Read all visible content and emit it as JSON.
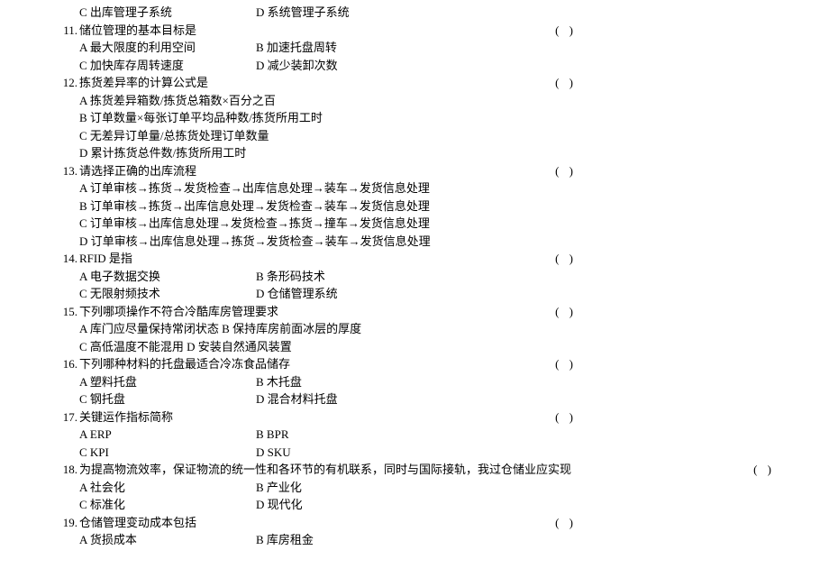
{
  "paren": "(   )",
  "pre_options": {
    "c": "C 出库管理子系统",
    "d": "D 系统管理子系统"
  },
  "questions": [
    {
      "num": "11.",
      "text": "储位管理的基本目标是",
      "opts_rows": [
        {
          "a": "A 最大限度的利用空间",
          "b": "B 加速托盘周转"
        },
        {
          "a": "C 加快库存周转速度",
          "b": "D 减少装卸次数"
        }
      ]
    },
    {
      "num": "12.",
      "text": "拣货差异率的计算公式是",
      "full_opts": [
        "A 拣货差异箱数/拣货总箱数×百分之百",
        "B 订单数量×每张订单平均品种数/拣货所用工时",
        "C 无差异订单量/总拣货处理订单数量",
        "D 累计拣货总件数/拣货所用工时"
      ]
    },
    {
      "num": "13.",
      "text": "请选择正确的出库流程",
      "full_opts": [
        "A 订单审核→拣货→发货检查→出库信息处理→装车→发货信息处理",
        "B 订单审核→拣货→出库信息处理→发货检查→装车→发货信息处理",
        "C 订单审核→出库信息处理→发货检查→拣货→撞车→发货信息处理",
        "D 订单审核→出库信息处理→拣货→发货检查→装车→发货信息处理"
      ]
    },
    {
      "num": "14.",
      "text": "RFID 是指",
      "opts_rows": [
        {
          "a": "A 电子数据交换",
          "b": "B 条形码技术"
        },
        {
          "a": "C 无限射频技术",
          "b": "D 仓储管理系统"
        }
      ]
    },
    {
      "num": "15.",
      "text": "下列哪项操作不符合冷酷库房管理要求",
      "full_opts": [
        "A 库门应尽量保持常闭状态 B 保持库房前面冰层的厚度",
        "C 高低温度不能混用 D 安装自然通风装置"
      ]
    },
    {
      "num": "16.",
      "text": "下列哪种材料的托盘最适合冷冻食品储存",
      "opts_rows": [
        {
          "a": "A 塑料托盘",
          "b": "B 木托盘"
        },
        {
          "a": "C 钢托盘",
          "b": "D 混合材料托盘"
        }
      ]
    },
    {
      "num": "17.",
      "text": "关键运作指标简称",
      "opts_rows": [
        {
          "a": "A ERP",
          "b": "B BPR"
        },
        {
          "a": "C KPI",
          "b": "D SKU"
        }
      ]
    },
    {
      "num": "18.",
      "text": "为提高物流效率，保证物流的统一性和各环节的有机联系，同时与国际接轨，我过仓储业应实现",
      "wide": true,
      "opts_rows": [
        {
          "a": "A 社会化",
          "b": "B 产业化"
        },
        {
          "a": "C 标准化",
          "b": "D 现代化"
        }
      ]
    },
    {
      "num": "19.",
      "text": "仓储管理变动成本包括",
      "opts_rows": [
        {
          "a": "A 货损成本",
          "b": "B 库房租金"
        }
      ]
    }
  ]
}
